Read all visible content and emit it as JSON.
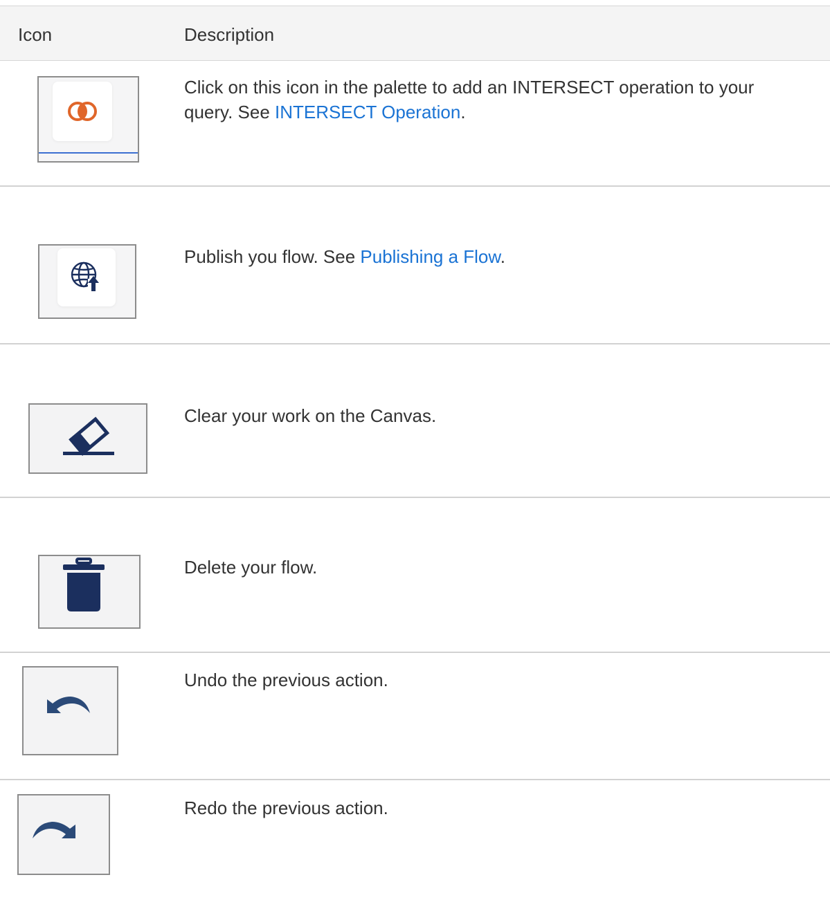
{
  "header": {
    "icon_col": "Icon",
    "desc_col": "Description"
  },
  "rows": [
    {
      "icon": "intersect-icon",
      "icon_color": "#e0662a",
      "text_before": "Click on this icon in the palette to add an INTERSECT operation to your query. See ",
      "link": "INTERSECT Operation",
      "text_after": "."
    },
    {
      "icon": "publish-globe-icon",
      "icon_color": "#1b2f5e",
      "text_before": "Publish you flow. See ",
      "link": "Publishing a Flow",
      "text_after": "."
    },
    {
      "icon": "eraser-icon",
      "icon_color": "#1b2f5e",
      "text": "Clear your work on the Canvas."
    },
    {
      "icon": "trash-icon",
      "icon_color": "#1b2f5e",
      "text": "Delete your flow."
    },
    {
      "icon": "undo-icon",
      "icon_color": "#1b2f5e",
      "text": "Undo the previous action."
    },
    {
      "icon": "redo-icon",
      "icon_color": "#1b2f5e",
      "text": "Redo the previous action."
    }
  ]
}
